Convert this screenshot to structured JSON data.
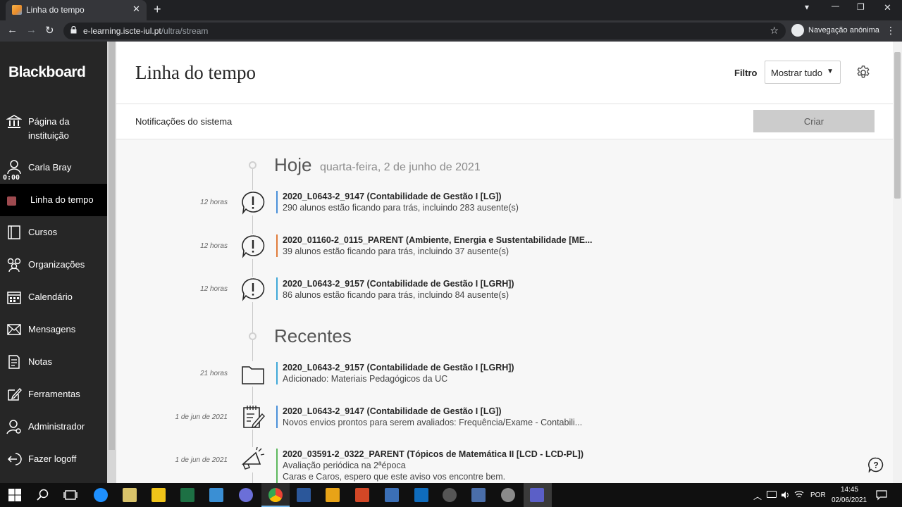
{
  "browser": {
    "tab_title": "Linha do tempo",
    "tab_close": "✕",
    "new_tab": "+",
    "url_host": "e-learning.iscte-iul.pt",
    "url_path": "/ultra/stream",
    "incognito_label": "Navegação anónima",
    "back": "←",
    "forward": "→",
    "reload": "↻",
    "star": "☆",
    "menu": "⋮",
    "minimize": "—",
    "maximize": "❐",
    "close": "✕",
    "profile_dropdown": "▾"
  },
  "sidebar": {
    "logo": "Blackboard",
    "timer": "0:00",
    "items": [
      {
        "label_line1": "Página da",
        "label_line2": "instituição",
        "icon": "institution-icon"
      },
      {
        "label": "Carla Bray",
        "icon": "user-icon"
      },
      {
        "label": "Linha do tempo",
        "icon": "timeline-icon",
        "active": true
      },
      {
        "label": "Cursos",
        "icon": "courses-icon"
      },
      {
        "label": "Organizações",
        "icon": "organizations-icon"
      },
      {
        "label": "Calendário",
        "icon": "calendar-icon"
      },
      {
        "label": "Mensagens",
        "icon": "messages-icon"
      },
      {
        "label": "Notas",
        "icon": "grades-icon"
      },
      {
        "label": "Ferramentas",
        "icon": "tools-icon"
      },
      {
        "label": "Administrador",
        "icon": "admin-icon"
      },
      {
        "label": "Fazer logoff",
        "icon": "logout-icon"
      }
    ]
  },
  "header": {
    "title": "Linha do tempo",
    "filter_label": "Filtro",
    "filter_value": "Mostrar tudo"
  },
  "notifications": {
    "label": "Notificações do sistema",
    "create_button": "Criar"
  },
  "sections": {
    "today": {
      "title": "Hoje",
      "date": "quarta-feira, 2 de junho de 2021"
    },
    "recent": {
      "title": "Recentes"
    }
  },
  "entries": [
    {
      "time": "12 horas",
      "icon": "alert-icon",
      "color": "#4a90d9",
      "title": "2020_L0643-2_9147 (Contabilidade de Gestão I [LG])",
      "sub": "290 alunos estão ficando para trás, incluindo 283 ausente(s)"
    },
    {
      "time": "12 horas",
      "icon": "alert-icon",
      "color": "#e07b3a",
      "title": "2020_01160-2_0115_PARENT (Ambiente, Energia e Sustentabilidade [ME...",
      "sub": "39 alunos estão ficando para trás, incluindo 37 ausente(s)"
    },
    {
      "time": "12 horas",
      "icon": "alert-icon",
      "color": "#3fa8d8",
      "title": "2020_L0643-2_9157 (Contabilidade de Gestão I [LGRH])",
      "sub": "86 alunos estão ficando para trás, incluindo 84 ausente(s)"
    },
    {
      "time": "21 horas",
      "icon": "folder-icon",
      "color": "#3fa8d8",
      "title": "2020_L0643-2_9157 (Contabilidade de Gestão I [LGRH])",
      "sub": "Adicionado: Materiais Pedagógicos da UC"
    },
    {
      "time": "1 de jun de 2021",
      "icon": "assignment-icon",
      "color": "#4a90d9",
      "title": "2020_L0643-2_9147 (Contabilidade de Gestão I [LG])",
      "sub": "Novos envios prontos para serem avaliados: Frequência/Exame - Contabili..."
    },
    {
      "time": "1 de jun de 2021",
      "icon": "megaphone-icon",
      "color": "#5cb85c",
      "title": "2020_03591-2_0322_PARENT (Tópicos de Matemática II [LCD - LCD-PL])",
      "sub": "Avaliação periódica na 2ªépoca",
      "sub2": "Caras e Caros, espero que este aviso vos encontre bem."
    }
  ],
  "taskbar": {
    "tray_lang": "POR",
    "time": "14:45",
    "date": "02/06/2021",
    "caret": "︿"
  },
  "colors": {
    "sidebar_bg": "#262626",
    "main_bg": "#f7f7f7",
    "chrome_bg": "#202124"
  }
}
